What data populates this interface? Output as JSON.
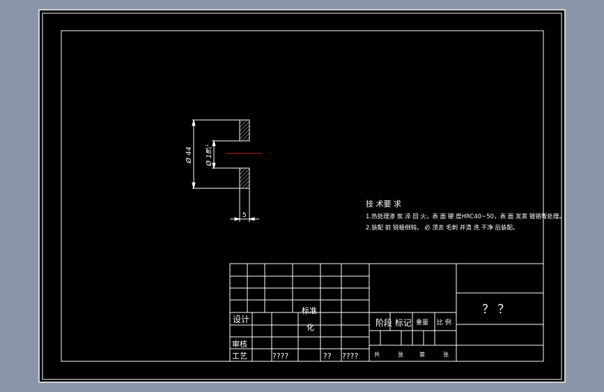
{
  "colors": {
    "background": "#8d96a8",
    "sheet": "#000000",
    "line": "#ffffff",
    "centerline": "#d21f1f"
  },
  "part": {
    "outer_diameter": "Ø 44",
    "inner_diameter": "Ø 18",
    "inner_tolerance_upper": "+0.1",
    "inner_tolerance_lower": "0",
    "thickness": "5"
  },
  "tech_requirements": {
    "heading": "技 术要 求",
    "line1": "1.热处理渗 炭 淬 回 火，表 面 硬 度HRC40~50，表 面 发黑 镀铬等处理。",
    "line2": "2.装配 前 锐棱倒钝， 必 须去 毛刺 并清 洗 干净 后装配。"
  },
  "title_block": {
    "design": "设计",
    "standardize_1": "标准",
    "standardize_2": "化",
    "review": "审核",
    "process": "工艺",
    "stage_mark": "阶段 标记",
    "weight": "重量",
    "scale": "比 例",
    "drawing_title": "？ ？",
    "unknown_1": "????",
    "unknown_2": "??",
    "unknown_3": "????",
    "total": "共",
    "sheets_1": "张",
    "page": "第",
    "sheets_2": "张"
  }
}
